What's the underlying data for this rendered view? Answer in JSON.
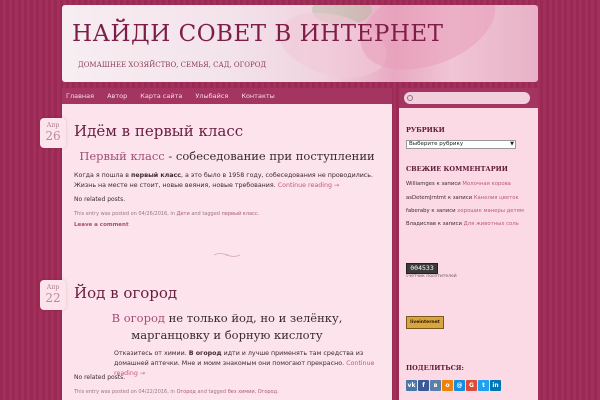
{
  "header": {
    "title": "НАЙДИ СОВЕТ В ИНТЕРНЕТ",
    "description": "ДОМАШНЕЕ ХОЗЯЙСТВО, СЕМЬЯ, САД, ОГОРОД"
  },
  "nav": {
    "items": [
      "Главная",
      "Автор",
      "Карта сайта",
      "Улыбайся",
      "Контакты"
    ]
  },
  "posts": [
    {
      "month": "Апр",
      "day": "26",
      "title": "Идём в первый класс",
      "sub_link": "Первый класс",
      "sub_rest": " - собеседование при поступлении",
      "text_before": "Когда я пошла в ",
      "text_bold": "первый класс",
      "text_after": ", а это было в 1958 году, собеседования не проводились. Жизнь на месте не стоит, новые веяния, новые требования.",
      "more": "Continue reading →",
      "no_related": "No related posts.",
      "meta_text": "This entry was posted on 04/26/2016, in ",
      "meta_cat": "Дети",
      "meta_and": " and tagged ",
      "meta_tag": "первый класс",
      "meta_end": ".",
      "leave_comment": "Leave a comment"
    },
    {
      "month": "Апр",
      "day": "22",
      "title": "Йод в огород",
      "sub_link": "В огород",
      "sub_rest": " не только йод, но и зелёнку, марганцовку и борную кислоту",
      "text_before": "Отказитесь от химии. ",
      "text_bold": "В огород",
      "text_after": " идти и лучше применять там средства из домашней аптечки. Мне и моим знакомым они помогают прекрасно.",
      "more": "Continue reading →",
      "no_related": "No related posts.",
      "meta_text": "This entry was posted on 04/22/2016, in ",
      "meta_cat": "Огород",
      "meta_and": " and tagged ",
      "meta_tag": "без химии",
      "meta_tag2": "Огород",
      "meta_end": "."
    }
  ],
  "sidebar": {
    "search_placeholder": "",
    "rubrics_title": "РУБРИКИ",
    "rubrics_select": "Выберите рубрику",
    "comments_title": "СВЕЖИЕ КОММЕНТАРИИ",
    "comments": [
      {
        "author": "Williamges",
        "on": " к записи ",
        "post": "Молочная корова"
      },
      {
        "author": "asDetemJrntmt",
        "on": " к записи ",
        "post": "Канелия цветок"
      },
      {
        "author": "faberaby",
        "on": " к записи ",
        "post": "хорошие манеры детям"
      },
      {
        "author": "Владислав",
        "on": " к записи ",
        "post": "Для животных соль"
      }
    ],
    "counter_value": "004533",
    "counter_label": "счетчик посетителей",
    "banner_text": "liveinternet",
    "share_title": "ПОДЕЛИТЬСЯ:",
    "share": [
      {
        "label": "vk",
        "color": "#4a76a8"
      },
      {
        "label": "f",
        "color": "#3b5998"
      },
      {
        "label": "в",
        "color": "#5a7fa8"
      },
      {
        "label": "o",
        "color": "#ee8208"
      },
      {
        "label": "@",
        "color": "#168de2"
      },
      {
        "label": "G",
        "color": "#dd4b39"
      },
      {
        "label": "t",
        "color": "#1da1f2"
      },
      {
        "label": "in",
        "color": "#0077b5"
      }
    ]
  }
}
